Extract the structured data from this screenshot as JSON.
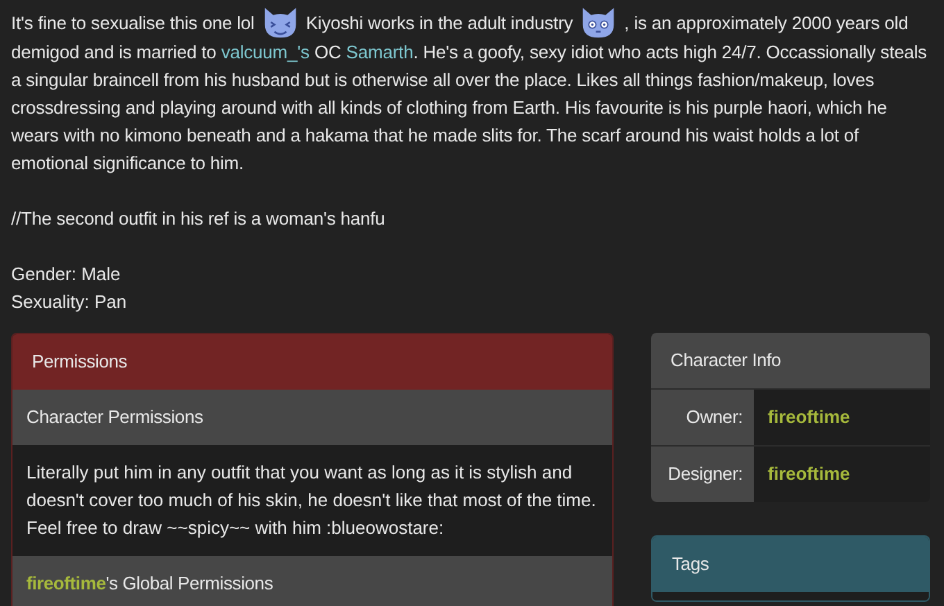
{
  "description": [
    {
      "kind": "text",
      "text": "It's fine to sexualise this one lol "
    },
    {
      "kind": "laugh"
    },
    {
      "kind": "text",
      "text": " Kiyoshi works in the adult industry "
    },
    {
      "kind": "stare"
    },
    {
      "kind": "text",
      "text": " , is an approximately 2000 years old demigod and is married to "
    },
    {
      "kind": "link",
      "text": "valcuum_'s"
    },
    {
      "kind": "text",
      "text": " OC "
    },
    {
      "kind": "link",
      "text": "Samarth"
    },
    {
      "kind": "text",
      "text": ". He's a goofy, sexy idiot who acts high 24/7. Occassionally steals a singular braincell from his husband but is otherwise all over the place. Likes all things fashion/makeup, loves crossdressing and playing around with all kinds of clothing from Earth. His favourite is his purple haori, which he wears with no kimono beneath and a hakama that he made slits for. The scarf around his waist holds a lot of emotional significance to him."
    }
  ],
  "notes": [
    "//The second outfit in his ref is a woman's hanfu"
  ],
  "facts": [
    "Gender: Male",
    "Sexuality: Pan"
  ],
  "permissions": {
    "title": "Permissions",
    "sections": [
      {
        "kind": "heading",
        "text": "Character Permissions"
      },
      {
        "kind": "body",
        "text": "Literally put him in any outfit that you want as long as it is stylish and doesn't cover too much of his skin, he doesn't like that most of the time. Feel free to draw ~~spicy~~ with him :blueowostare:"
      },
      {
        "kind": "user-heading",
        "user": "fireoftime",
        "text": "'s Global Permissions"
      }
    ]
  },
  "character_info": {
    "title": "Character Info",
    "rows": [
      {
        "label": "Owner:",
        "value": "fireoftime"
      },
      {
        "label": "Designer:",
        "value": "fireoftime"
      }
    ]
  },
  "tags": {
    "title": "Tags"
  }
}
